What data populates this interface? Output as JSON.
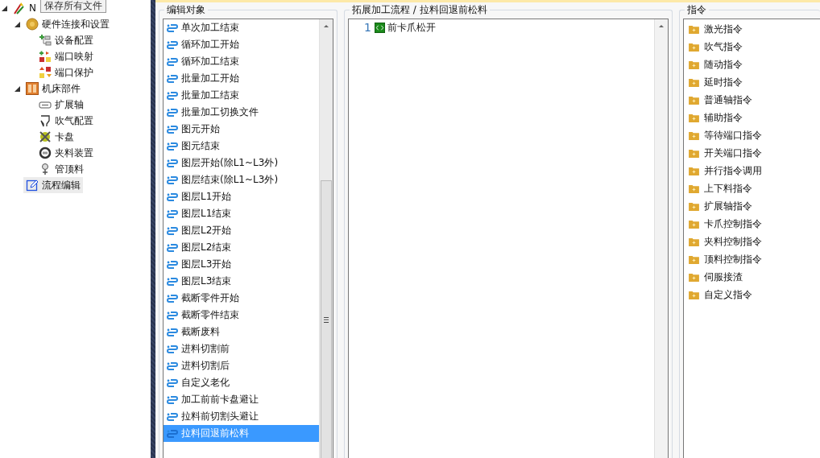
{
  "tooltip": {
    "text": "保存所有文件"
  },
  "tree": {
    "root": {
      "label": "N",
      "kind": "root",
      "expanded": true,
      "selected": false,
      "children": [
        {
          "label": "硬件连接和设置",
          "kind": "hardware",
          "expanded": true,
          "selected": false,
          "children": [
            {
              "label": "设备配置",
              "kind": "device",
              "selected": false
            },
            {
              "label": "端口映射",
              "kind": "port-map",
              "selected": false
            },
            {
              "label": "端口保护",
              "kind": "port-protect",
              "selected": false
            }
          ]
        },
        {
          "label": "机床部件",
          "kind": "machine",
          "expanded": true,
          "selected": false,
          "children": [
            {
              "label": "扩展轴",
              "kind": "axis",
              "selected": false
            },
            {
              "label": "吹气配置",
              "kind": "blow",
              "selected": false
            },
            {
              "label": "卡盘",
              "kind": "chuck",
              "selected": false
            },
            {
              "label": "夹料装置",
              "kind": "clamp",
              "selected": false
            },
            {
              "label": "管顶料",
              "kind": "tube",
              "selected": false
            }
          ]
        },
        {
          "label": "流程编辑",
          "kind": "flow",
          "selected": true
        }
      ]
    }
  },
  "object_list": {
    "title": "编辑对象",
    "items": [
      {
        "label": "单次加工结束",
        "selected": false
      },
      {
        "label": "循环加工开始",
        "selected": false
      },
      {
        "label": "循环加工结束",
        "selected": false
      },
      {
        "label": "批量加工开始",
        "selected": false
      },
      {
        "label": "批量加工结束",
        "selected": false
      },
      {
        "label": "批量加工切换文件",
        "selected": false
      },
      {
        "label": "图元开始",
        "selected": false
      },
      {
        "label": "图元结束",
        "selected": false
      },
      {
        "label": "图层开始(除L1~L3外)",
        "selected": false
      },
      {
        "label": "图层结束(除L1~L3外)",
        "selected": false
      },
      {
        "label": "图层L1开始",
        "selected": false
      },
      {
        "label": "图层L1结束",
        "selected": false
      },
      {
        "label": "图层L2开始",
        "selected": false
      },
      {
        "label": "图层L2结束",
        "selected": false
      },
      {
        "label": "图层L3开始",
        "selected": false
      },
      {
        "label": "图层L3结束",
        "selected": false
      },
      {
        "label": "截断零件开始",
        "selected": false
      },
      {
        "label": "截断零件结束",
        "selected": false
      },
      {
        "label": "截断废料",
        "selected": false
      },
      {
        "label": "进料切割前",
        "selected": false
      },
      {
        "label": "进料切割后",
        "selected": false
      },
      {
        "label": "自定义老化",
        "selected": false
      },
      {
        "label": "加工前前卡盘避让",
        "selected": false
      },
      {
        "label": "拉料前切割头避让",
        "selected": false
      },
      {
        "label": "拉料回退前松料",
        "selected": true
      }
    ]
  },
  "editor": {
    "title": "拓展加工流程 / 拉料回退前松料",
    "lines": [
      {
        "number": "1",
        "text": "前卡爪松开"
      }
    ]
  },
  "commands": {
    "title": "指令",
    "items": [
      {
        "label": "激光指令"
      },
      {
        "label": "吹气指令"
      },
      {
        "label": "随动指令"
      },
      {
        "label": "延时指令"
      },
      {
        "label": "普通轴指令"
      },
      {
        "label": "辅助指令"
      },
      {
        "label": "等待端口指令"
      },
      {
        "label": "开关端口指令"
      },
      {
        "label": "并行指令调用"
      },
      {
        "label": "上下料指令"
      },
      {
        "label": "扩展轴指令"
      },
      {
        "label": "卡爪控制指令"
      },
      {
        "label": "夹料控制指令"
      },
      {
        "label": "顶料控制指令"
      },
      {
        "label": "伺服接渣"
      },
      {
        "label": "自定义指令"
      }
    ]
  }
}
